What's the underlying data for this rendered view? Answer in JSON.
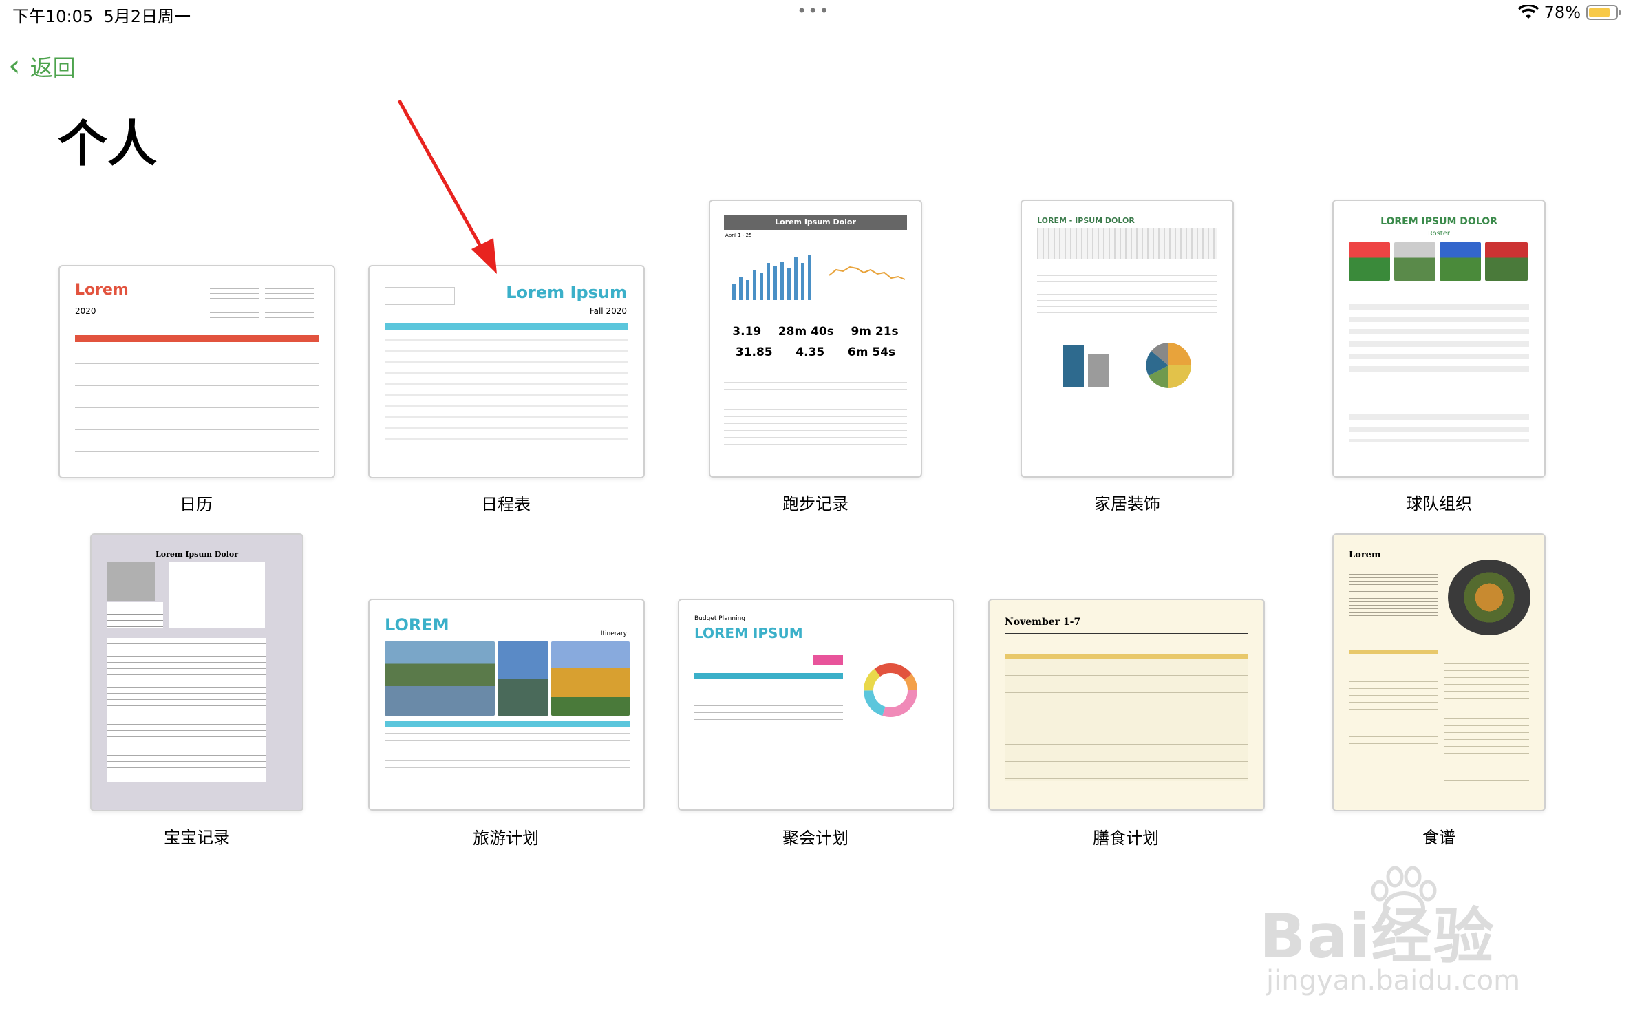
{
  "status": {
    "time": "下午10:05",
    "date": "5月2日周一",
    "dots": "•••",
    "battery": "78%"
  },
  "nav": {
    "back_label": "返回",
    "title": "个人"
  },
  "templates": [
    {
      "label": "日历",
      "t1": "Lorem",
      "t2": "2020"
    },
    {
      "label": "日程表",
      "t1": "Lorem Ipsum",
      "t2": "Fall 2020"
    },
    {
      "label": "跑步记录",
      "t1": "Lorem Ipsum Dolor",
      "t2": "April 1 - 25",
      "v1": "3.19",
      "v2": "28m 40s",
      "v3": "9m 21s",
      "v4": "31.85",
      "v5": "4.35",
      "v6": "6m 54s"
    },
    {
      "label": "家居装饰",
      "t1": "LOREM - IPSUM DOLOR"
    },
    {
      "label": "球队组织",
      "t1": "LOREM IPSUM DOLOR",
      "t2": "Roster"
    },
    {
      "label": "宝宝记录",
      "t1": "Lorem Ipsum Dolor"
    },
    {
      "label": "旅游计划",
      "t1": "LOREM",
      "t2": "Itinerary"
    },
    {
      "label": "聚会计划",
      "t1": "Budget Planning",
      "t2": "LOREM IPSUM"
    },
    {
      "label": "膳食计划",
      "t1": "November 1-7"
    },
    {
      "label": "食谱",
      "t1": "Lorem"
    }
  ],
  "watermark": {
    "main": "Bai经验",
    "sub": "jingyan.baidu.com"
  }
}
